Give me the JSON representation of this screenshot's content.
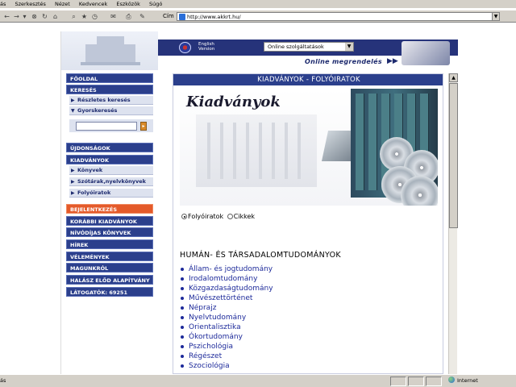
{
  "browser": {
    "menu": [
      "ás",
      "Szerkesztés",
      "Nézet",
      "Kedvencek",
      "Eszközök",
      "Súgó"
    ],
    "address_label": "Cím",
    "address_value": "http://www.akkrt.hu/",
    "status_left": "ás",
    "status_zone": "Internet"
  },
  "header": {
    "english_line1": "English",
    "english_line2": "Version",
    "online_select": "Online szolgáltatások",
    "online_order": "Online megrendelés"
  },
  "nav": {
    "fooldal": "FŐOLDAL",
    "kereses": "KERESÉS",
    "reszletes": "Részletes keresés",
    "gyorskereses": "Gyorskeresés",
    "ujdonsagok": "ÚJDONSÁGOK",
    "kiadvanyok": "KIADVÁNYOK",
    "konyvek": "Könyvek",
    "szotarak": "Szótárak,nyelvkönyvek",
    "folyoiratok": "Folyóiratok",
    "bejelentkezes": "BEJELENTKEZÉS",
    "korabbi": "KORÁBBI KIADVÁNYOK",
    "nivodijas": "NÍVÓDÍJAS KÖNYVEK",
    "hirek": "HÍREK",
    "velemenyek": "VÉLEMÉNYEK",
    "magunkrol": "MAGUNKRÓL",
    "alapitvany": "HALÁSZ ELŐD ALAPÍTVÁNY",
    "latogatok": "LÁTOGATÓK: 69251"
  },
  "content": {
    "section_title": "KIADVÁNYOK - FOLYÓIRATOK",
    "hero_title": "Kiadványok",
    "radio_folyoiratok": "Folyóiratok",
    "radio_cikkek": "Cikkek",
    "category_heading": "HUMÁN- ÉS TÁRSADALOMTUDOMÁNYOK",
    "categories": [
      "Állam- és jogtudomány",
      "Irodalomtudomány",
      "Közgazdaságtudomány",
      "Művészettörténet",
      "Néprajz",
      "Nyelvtudomány",
      "Orientalisztika",
      "Ókortudomány",
      "Pszichológia",
      "Régészet",
      "Szociológia"
    ]
  }
}
